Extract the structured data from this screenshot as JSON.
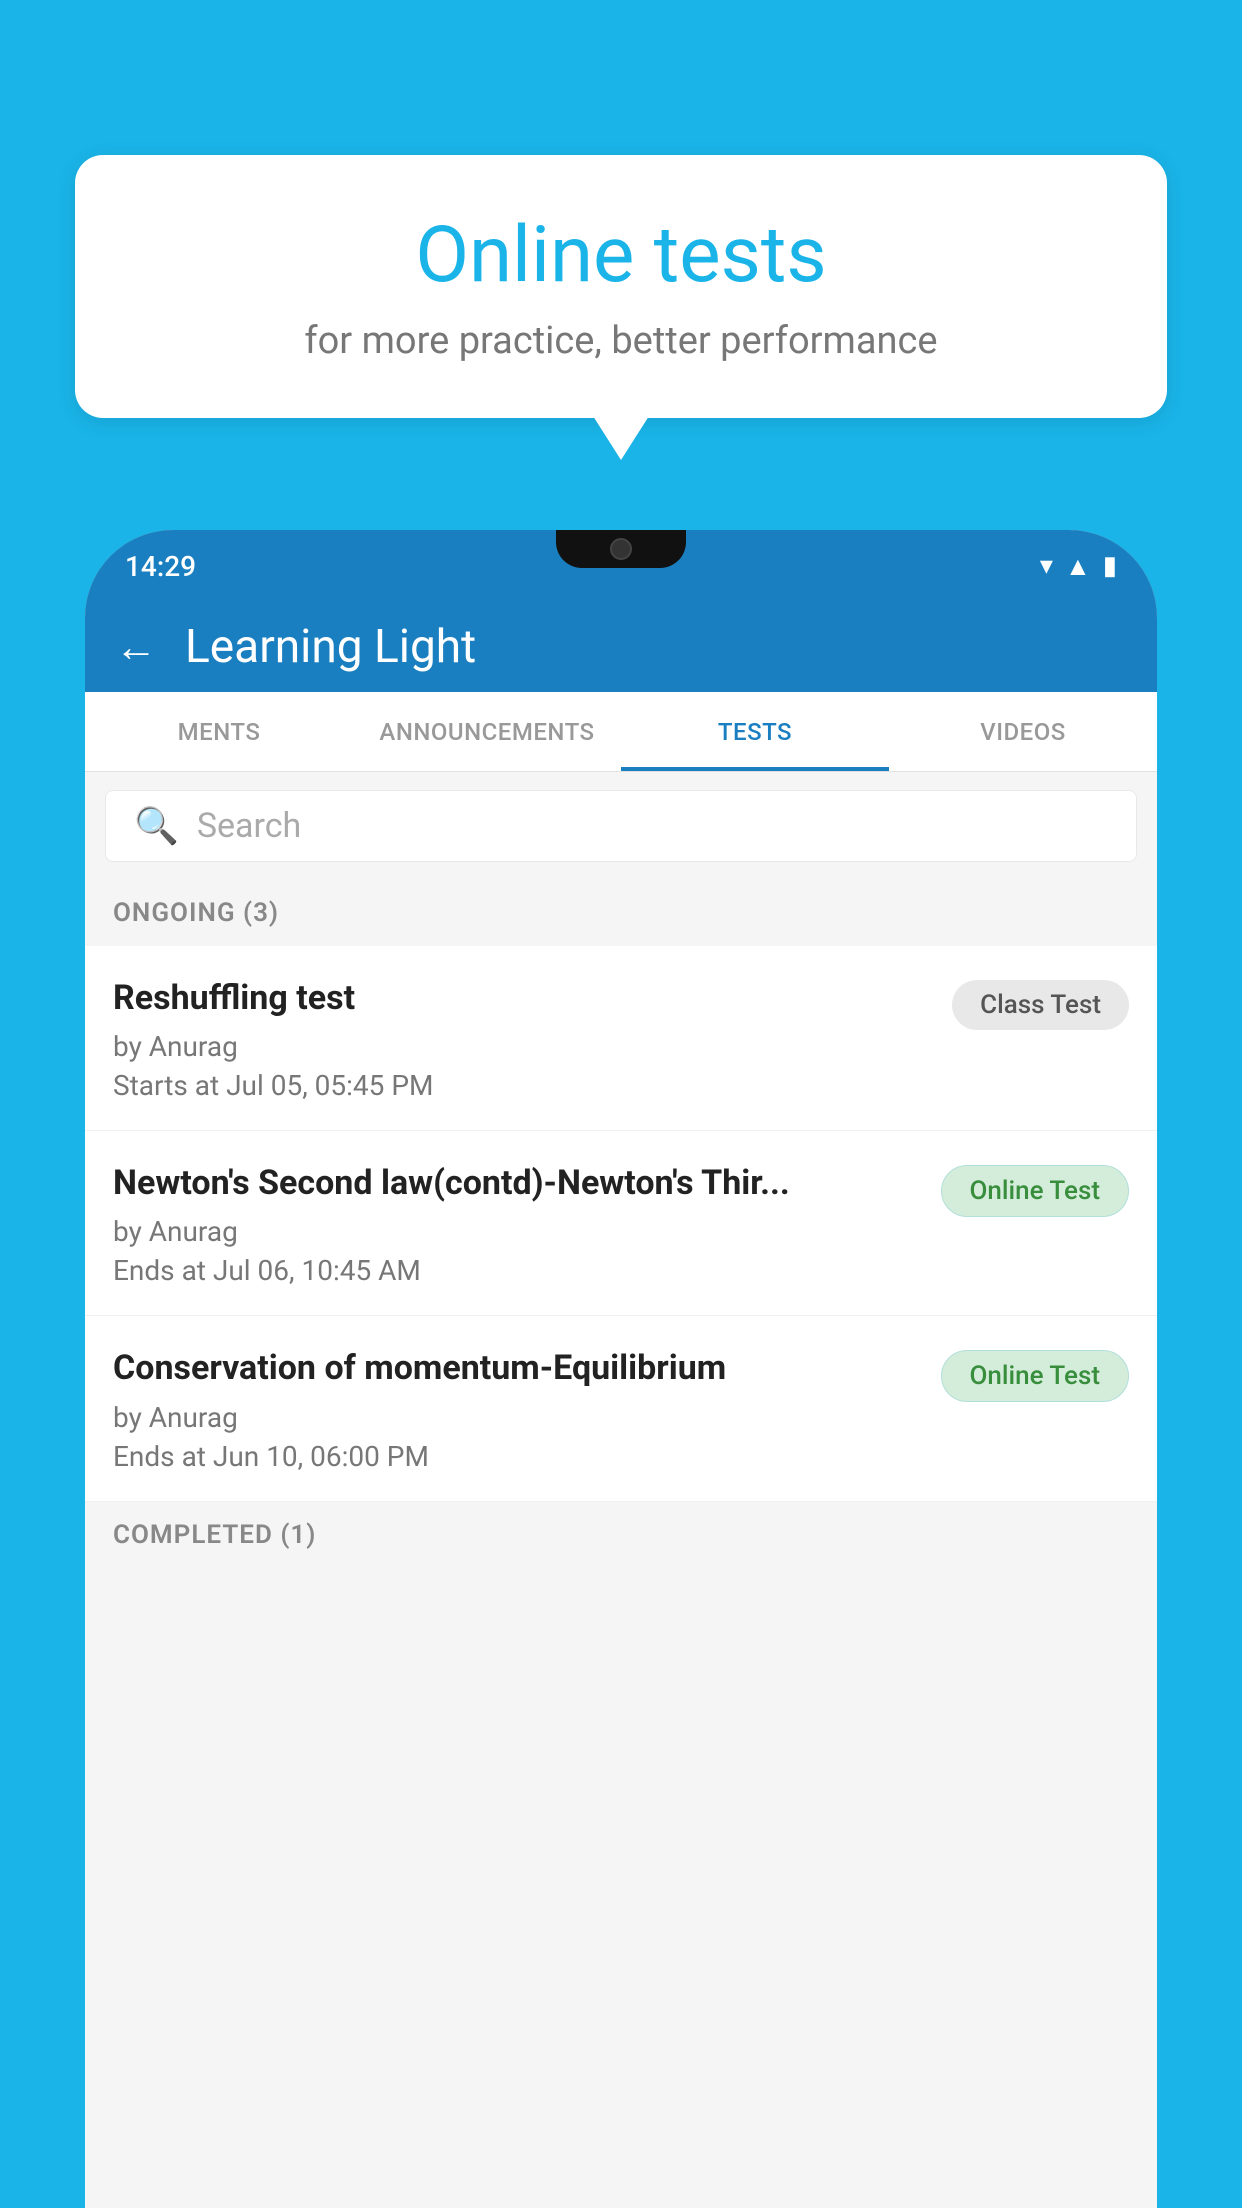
{
  "background_color": "#1ab4e8",
  "bubble": {
    "title": "Online tests",
    "subtitle": "for more practice, better performance"
  },
  "phone": {
    "status_time": "14:29",
    "app_title": "Learning Light",
    "back_label": "←",
    "tabs": [
      {
        "label": "MENTS",
        "active": false
      },
      {
        "label": "ANNOUNCEMENTS",
        "active": false
      },
      {
        "label": "TESTS",
        "active": true
      },
      {
        "label": "VIDEOS",
        "active": false
      }
    ],
    "search_placeholder": "Search",
    "ongoing_header": "ONGOING (3)",
    "tests": [
      {
        "name": "Reshuffling test",
        "by": "by Anurag",
        "date": "Starts at  Jul 05, 05:45 PM",
        "badge": "Class Test",
        "badge_type": "class"
      },
      {
        "name": "Newton's Second law(contd)-Newton's Thir...",
        "by": "by Anurag",
        "date": "Ends at  Jul 06, 10:45 AM",
        "badge": "Online Test",
        "badge_type": "online"
      },
      {
        "name": "Conservation of momentum-Equilibrium",
        "by": "by Anurag",
        "date": "Ends at  Jun 10, 06:00 PM",
        "badge": "Online Test",
        "badge_type": "online"
      }
    ],
    "completed_header": "COMPLETED (1)"
  }
}
